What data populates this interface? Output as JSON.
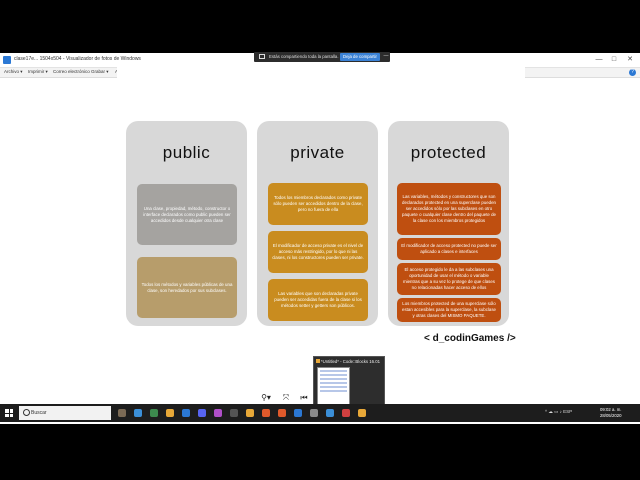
{
  "window": {
    "title": "clase17e... 1504x504 - Visualizador de fotos de Windows",
    "minimize": "—",
    "maximize": "□",
    "close": "✕"
  },
  "menu": {
    "items": [
      "Archivo ▾",
      "Imprimir ▾",
      "Correo electrónico",
      "Grabar ▾",
      "Abrir ▾"
    ],
    "help": "?"
  },
  "share_bar": {
    "text": "Estás compartiendo toda la pantalla.",
    "stop_label": "Deja de compartir",
    "hide_label": "—"
  },
  "slide": {
    "columns": [
      {
        "title": "public",
        "cards": [
          "Una clase, propiedad, método, constructor o interface declarados como public pueden ser accedidos desde cualquier otra clase",
          "Todos los métodos y variables públicas de una clase, son heredados por sus subclases."
        ]
      },
      {
        "title": "private",
        "cards": [
          "Todos los miembros declarados como private sólo pueden ser accedidos dentro de la clase, pero no fuera de ella",
          "El modificador de acceso private es el nivel de acceso más restringido, por lo que ni las clases, ni los constructores pueden ser private.",
          "Las variables que son declaradas private pueden ser accedidas fuera de la clase si los métodos setter y getters son públicos."
        ]
      },
      {
        "title": "protected",
        "cards": [
          "Las variables, métodos y constructores que son declarados protected en una superclase pueden ser accedidos sólo por las subclases en otro paquete o cualquier clase dentro del paquete de la clase con los miembros protegidos",
          "El modificador de acceso protected no puede ser aplicado a clases e interfaces",
          "El acceso protegido le da a las subclases una oportunidad de usar el método o variable mientras que a su vez lo protege de que clases no relacionadas hacer acceso de ellos",
          "Los miembros protected de una superclase sólo estan accesibles para la superclase, la subclase y otras clases del MISMO PAQUETE."
        ]
      }
    ],
    "brand": "< d_codinGames />"
  },
  "viewer_toolbar": {
    "zoom": "⚲▾",
    "actual_size": "⤧",
    "prev": "⏮",
    "slideshow": "▭",
    "next": "⏭"
  },
  "taskbar": {
    "search_placeholder": "Buscar",
    "thumbnail_title": "*Untitled* - Code::Blocks 16.01",
    "tray_text": "^ ☁ ▭ ♪ ESP",
    "clock_time": "09:02 a. m.",
    "clock_date": "28/05/2020",
    "app_colors": [
      "#7b6a55",
      "#3b8fd8",
      "#3d8a4e",
      "#e8a838",
      "#2b78d4",
      "#5865f2",
      "#b04fc8",
      "#555555",
      "#e8a838",
      "#e05a2b",
      "#e05a2b",
      "#2b78d4",
      "#8a8a8a",
      "#3b8fd8",
      "#d04040",
      "#e8a838"
    ]
  },
  "colors": {
    "card_grey": "#a5a3a0",
    "card_tan": "#b79d6b",
    "card_gold": "#c98c1f",
    "card_rust": "#bf4f10",
    "column_bg": "#d8d8d8",
    "share_button": "#3b82d6"
  }
}
